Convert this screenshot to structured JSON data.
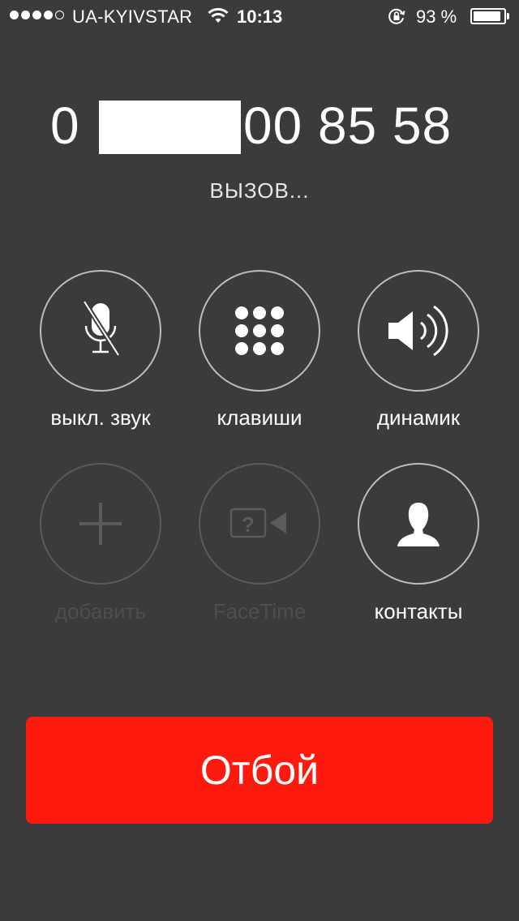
{
  "status_bar": {
    "signal_dots_filled": 4,
    "signal_dots_total": 5,
    "carrier": "UA-KYIVSTAR",
    "time": "10:13",
    "battery_percent_text": "93 %",
    "battery_level": 0.93,
    "icons": [
      "signal-dots-icon",
      "wifi-icon",
      "rotation-lock-icon",
      "battery-icon"
    ]
  },
  "call": {
    "number_prefix": "0",
    "number_suffix": "00 85 58",
    "status": "ВЫЗОВ..."
  },
  "buttons": {
    "mute": {
      "label": "выкл. звук",
      "icon": "microphone-muted-icon",
      "enabled": true
    },
    "keypad": {
      "label": "клавиши",
      "icon": "keypad-icon",
      "enabled": true
    },
    "speaker": {
      "label": "динамик",
      "icon": "speaker-icon",
      "enabled": true
    },
    "add": {
      "label": "добавить",
      "icon": "plus-icon",
      "enabled": false
    },
    "facetime": {
      "label": "FaceTime",
      "icon": "facetime-icon",
      "enabled": false
    },
    "contacts": {
      "label": "контакты",
      "icon": "contact-person-icon",
      "enabled": true
    }
  },
  "end_call": {
    "label": "Отбой"
  },
  "colors": {
    "background": "#3b3b3b",
    "end_call": "#fe1a0f",
    "circle_border": "#bdbdbd",
    "disabled": "#5b5b5b"
  }
}
